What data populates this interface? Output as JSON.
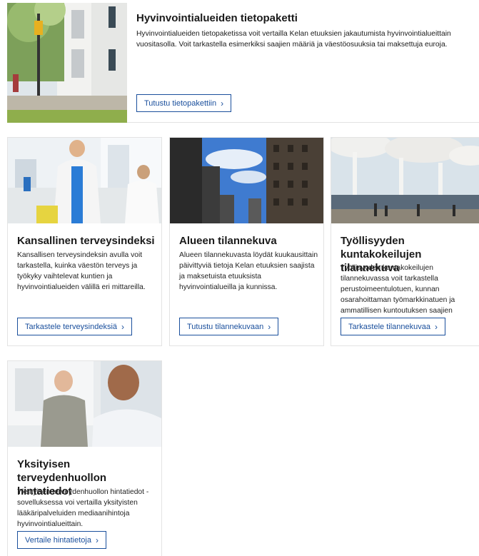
{
  "featured": {
    "title": "Hyvinvointialueiden tietopaketti",
    "description": "Hyvinvointialueiden tietopaketissa voit vertailla Kelan etuuksien jakautumista hyvinvointialueittain vuositasolla. Voit tarkastella esimerkiksi saajien määriä ja väestöosuuksia tai maksettuja euroja.",
    "button_label": "Tutustu tietopakettiin",
    "button_icon": "chevron-right-icon"
  },
  "cards": [
    {
      "title": "Kansallinen terveysindeksi",
      "description": "Kansallisen terveysindeksin avulla voit tarkastella, kuinka väestön terveys ja työkyky vaihtelevat kuntien ja hyvinvointialueiden välillä eri mittareilla.",
      "button_label": "Tarkastele terveysindeksiä"
    },
    {
      "title": "Alueen tilannekuva",
      "description": "Alueen tilannekuvasta löydät kuukausittain päivittyviä tietoja Kelan etuuksien saajista ja maksetuista etuuksista hyvinvointialueilla ja kunnissa.",
      "button_label": "Tutustu tilannekuvaan"
    },
    {
      "title": "Työllisyyden kuntakokeilujen tilannekuva",
      "description": "Työllisyyden kuntakokeilujen tilannekuvassa voit tarkastella perustoimeentulotuen, kunnan osarahoittaman työmarkkinatuen ja ammatillisen kuntoutuksen saajien määriä kuntakokeilualueilla.",
      "button_label": "Tarkastele tilannekuvaa"
    },
    {
      "title": "Yksityisen terveydenhuollon hintatiedot",
      "description": "Yksityisen terveydenhuollon hintatiedot -sovelluksessa voi vertailla yksityisten lääkäripalveluiden mediaanihintoja hyvinvointialueittain.",
      "button_label": "Vertaile hintatietoja"
    }
  ],
  "colors": {
    "link_blue": "#1a4f9c",
    "border": "#e3e3e3"
  }
}
